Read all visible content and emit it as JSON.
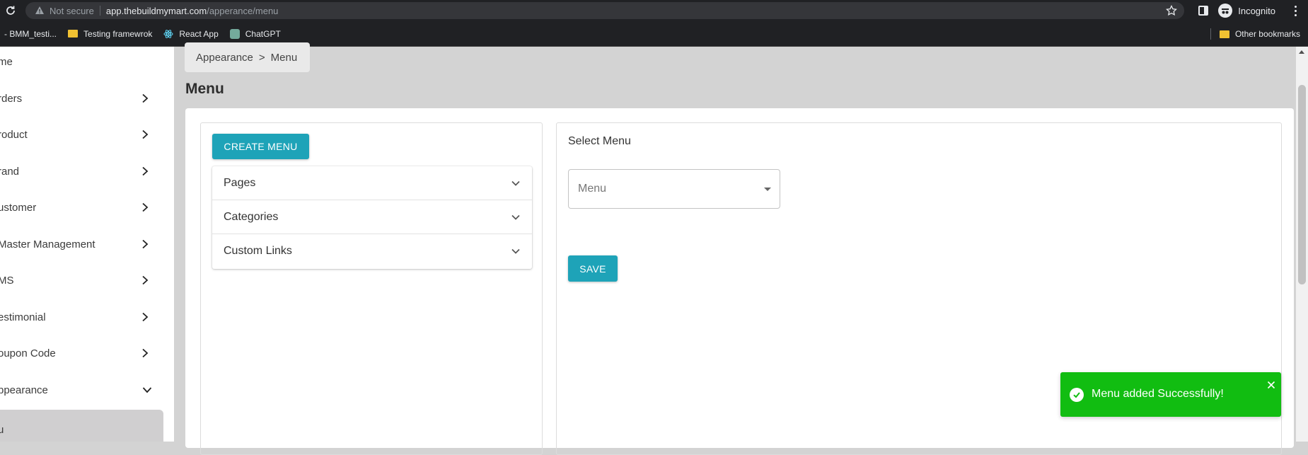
{
  "browser": {
    "security_text": "Not secure",
    "url_host": "app.thebuildmymart.com",
    "url_path": "/apperance/menu",
    "profile_label": "Incognito",
    "bookmarks": [
      {
        "label": "- BMM_testi...",
        "icon": "folder-icon"
      },
      {
        "label": "Testing framewrok",
        "icon": "folder-icon"
      },
      {
        "label": "React App",
        "icon": "react-icon"
      },
      {
        "label": "ChatGPT",
        "icon": "chatgpt-icon"
      }
    ],
    "other_bookmarks": "Other bookmarks"
  },
  "sidebar": {
    "items": [
      {
        "label": "me",
        "has_chevron": false
      },
      {
        "label": "rders",
        "has_chevron": true
      },
      {
        "label": "roduct",
        "has_chevron": true
      },
      {
        "label": "rand",
        "has_chevron": true
      },
      {
        "label": "ustomer",
        "has_chevron": true
      },
      {
        "label": "Master Management",
        "has_chevron": true
      },
      {
        "label": "MS",
        "has_chevron": true
      },
      {
        "label": "estimonial",
        "has_chevron": true
      },
      {
        "label": "oupon Code",
        "has_chevron": true
      },
      {
        "label": "ppearance",
        "has_chevron": true,
        "expanded": true
      }
    ],
    "active_item_label": "u"
  },
  "main": {
    "breadcrumb": {
      "parent": "Appearance",
      "separator": ">",
      "current": "Menu"
    },
    "title": "Menu",
    "create_button": "CREATE MENU",
    "accordion": [
      {
        "label": "Pages"
      },
      {
        "label": "Categories"
      },
      {
        "label": "Custom Links"
      }
    ],
    "select_label": "Select Menu",
    "select_placeholder": "Menu",
    "save_button": "SAVE"
  },
  "toast": {
    "message": "Menu added Successfully!",
    "color": "#11bd11"
  },
  "colors": {
    "accent": "#1ea3b8",
    "background": "#d3d3d3"
  }
}
